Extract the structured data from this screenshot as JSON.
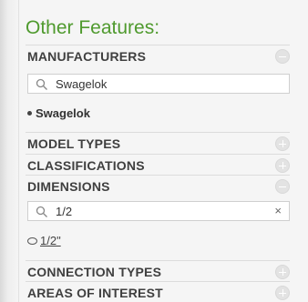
{
  "title": "Other Features:",
  "sections": {
    "manufacturers": {
      "label": "MANUFACTURERS",
      "state": "collapse"
    },
    "model_types": {
      "label": "MODEL TYPES",
      "state": "expand"
    },
    "classifications": {
      "label": "CLASSIFICATIONS",
      "state": "expand"
    },
    "dimensions": {
      "label": "DIMENSIONS",
      "state": "collapse"
    },
    "connection_types": {
      "label": "CONNECTION TYPES",
      "state": "expand"
    },
    "areas_of_interest": {
      "label": "AREAS OF INTEREST",
      "state": "expand"
    }
  },
  "manufacturer_search": {
    "value": "Swagelok"
  },
  "manufacturer_selected": "Swagelok",
  "dimension_search": {
    "value": "1/2",
    "clear_icon": "×"
  },
  "dimension_option": "1/2\"",
  "icons": {
    "collapse": "minus-circle-icon",
    "expand": "plus-circle-icon",
    "search": "search-icon",
    "clear": "clear-icon"
  },
  "colors": {
    "title": "#4f9a2e",
    "section_label": "#3f3f3f",
    "toggle": "#e3e3e3"
  }
}
